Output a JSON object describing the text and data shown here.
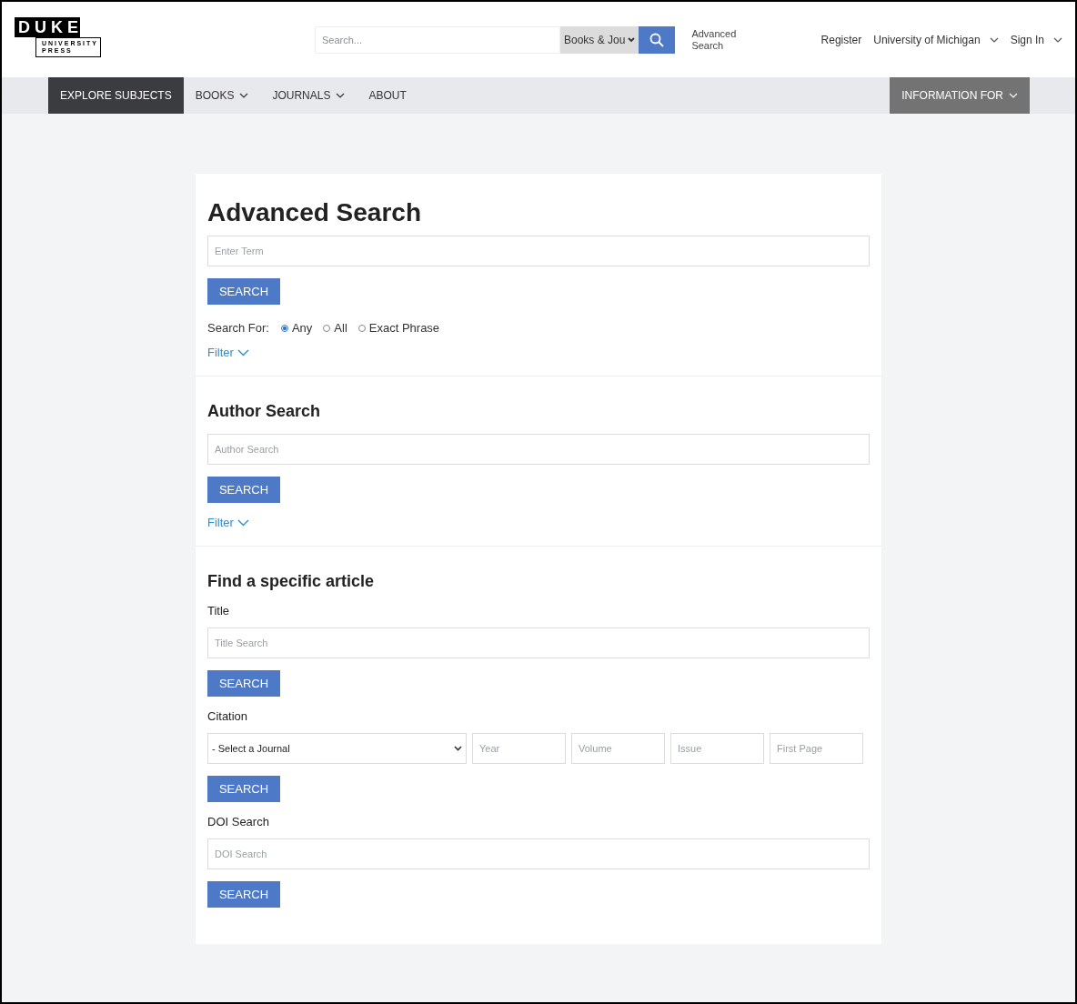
{
  "logo": {
    "word": "DUKE",
    "sub_lines": [
      "UNIVERSITY",
      "PRESS"
    ]
  },
  "header": {
    "search": {
      "placeholder": "Search..."
    },
    "scope": "Books & Jou",
    "advanced_link": "Advanced Search",
    "links": [
      {
        "label": "Register",
        "dropdown": false
      },
      {
        "label": "University of Michigan",
        "dropdown": true
      },
      {
        "label": "Sign In",
        "dropdown": true
      }
    ]
  },
  "nav": {
    "items": [
      {
        "label": "EXPLORE SUBJECTS",
        "selected": true,
        "dropdown": false
      },
      {
        "label": "BOOKS",
        "selected": false,
        "dropdown": true
      },
      {
        "label": "JOURNALS",
        "selected": false,
        "dropdown": true
      },
      {
        "label": "ABOUT",
        "selected": false,
        "dropdown": false
      }
    ],
    "info_button": "INFORMATION FOR"
  },
  "sections": [
    {
      "kind": "page",
      "title": "Advanced Search",
      "blocks": [
        {
          "kind": "field",
          "placeholder": "Enter Term"
        },
        {
          "kind": "button",
          "label": "SEARCH"
        },
        {
          "kind": "radios",
          "label": "Search For:",
          "options": [
            {
              "label": "Any",
              "selected": true
            },
            {
              "label": "All",
              "selected": false
            },
            {
              "label": "Exact Phrase",
              "selected": false
            }
          ]
        },
        {
          "kind": "filter",
          "label": "Filter"
        }
      ]
    },
    {
      "kind": "sub",
      "title": "Author Search",
      "blocks": [
        {
          "kind": "field",
          "placeholder": "Author Search"
        },
        {
          "kind": "button",
          "label": "SEARCH"
        },
        {
          "kind": "filter",
          "label": "Filter"
        }
      ]
    },
    {
      "kind": "sub",
      "title": "Find a specific article",
      "blocks": [
        {
          "kind": "label",
          "text": "Title"
        },
        {
          "kind": "field",
          "placeholder": "Title Search"
        },
        {
          "kind": "button",
          "label": "SEARCH"
        },
        {
          "kind": "label",
          "text": "Citation"
        },
        {
          "kind": "citation",
          "select": "- Select a Journal",
          "fields": [
            {
              "placeholder": "Year"
            },
            {
              "placeholder": "Volume"
            },
            {
              "placeholder": "Issue"
            },
            {
              "placeholder": "First Page"
            }
          ]
        },
        {
          "kind": "button",
          "label": "SEARCH"
        },
        {
          "kind": "label",
          "text": "DOI Search"
        },
        {
          "kind": "field",
          "placeholder": "DOI Search"
        },
        {
          "kind": "button",
          "label": "SEARCH"
        }
      ]
    }
  ]
}
